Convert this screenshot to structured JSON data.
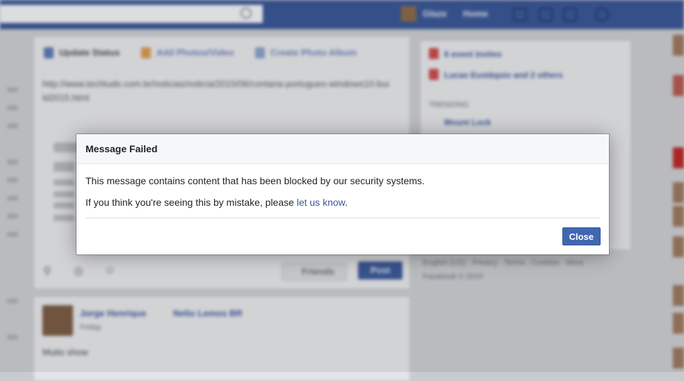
{
  "topbar": {
    "nav_name": "Glaze",
    "nav_home": "Home"
  },
  "composer": {
    "tabs": [
      {
        "label": "Update Status",
        "icon": "status-icon"
      },
      {
        "label": "Add Photos/Video",
        "icon": "photo-icon"
      },
      {
        "label": "Create Photo Album",
        "icon": "album-icon"
      }
    ],
    "text": "http://www.techtudo.com.br/noticias/noticia/2015/06/contaria-portugues-windows10-build2015.html",
    "audience": "Friends",
    "post_label": "Post"
  },
  "feed_post": {
    "author": "Jorge Henrique",
    "target": "Nelio Lemos BR",
    "time": "Friday",
    "text": "Muito show"
  },
  "right_column": {
    "events": "6 event invites",
    "friends": "Lucas Eustáquio and 2 others",
    "trending_label": "TRENDING",
    "trending_item": "Mount Lock",
    "footer_links": "English (US) · Privacy · Terms · Cookies · More",
    "copyright": "Facebook © 2015"
  },
  "dialog": {
    "title": "Message Failed",
    "message_1": "This message contains content that has been blocked by our security systems.",
    "message_2_prefix": "If you think you're seeing this by mistake, please ",
    "message_2_link": "let us know",
    "message_2_suffix": ".",
    "close_label": "Close"
  },
  "colors": {
    "topbar": "#3a5795",
    "primary_button": "#4267b2",
    "link": "#385898"
  }
}
